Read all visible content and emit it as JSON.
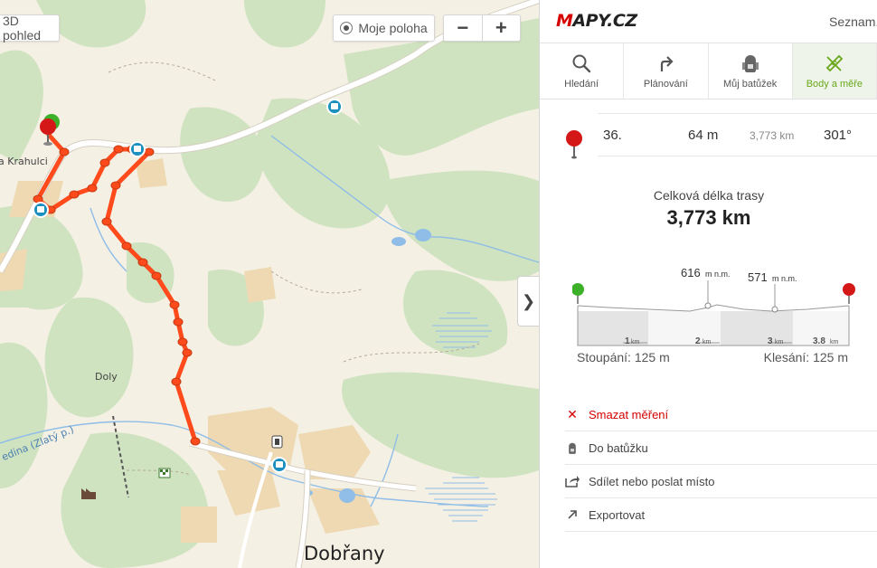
{
  "map": {
    "view3d_label": "3D pohled",
    "my_location_label": "Moje poloha",
    "zoom_out_label": "−",
    "zoom_in_label": "+",
    "collapse_label": "❯",
    "place_labels": {
      "krahulci": "a Krahulci",
      "doly": "Doly",
      "river": "edina (Zlatý p.)",
      "town": "Dobřany"
    }
  },
  "header": {
    "logo_initial": "M",
    "logo_rest": "APY.CZ",
    "account_label": "Seznam.c"
  },
  "tabs": [
    {
      "label": "Hledání",
      "icon": "search-icon"
    },
    {
      "label": "Plánování",
      "icon": "route-arrow-icon"
    },
    {
      "label": "Můj batůžek",
      "icon": "backpack-icon"
    },
    {
      "label": "Body a měře",
      "icon": "measure-ruler-icon",
      "active": true
    }
  ],
  "measurement": {
    "point": {
      "number": "36.",
      "elevation": "64 m",
      "distance": "3,773 km",
      "angle": "301°"
    },
    "total_label": "Celková délka trasy",
    "total_value": "3,773 km",
    "profile": {
      "peak1": {
        "value": "616",
        "unit": "m n.m."
      },
      "peak2": {
        "value": "571",
        "unit": "m n.m."
      },
      "ticks": [
        {
          "value": "1",
          "unit": "km"
        },
        {
          "value": "2",
          "unit": "km"
        },
        {
          "value": "3",
          "unit": "km"
        },
        {
          "value": "3.8",
          "unit": "km"
        }
      ]
    },
    "ascent": "Stoupání: 125 m",
    "descent": "Klesání: 125 m"
  },
  "actions": [
    {
      "label": "Smazat měření",
      "icon": "delete-x-icon"
    },
    {
      "label": "Do batůžku",
      "icon": "backpack-icon"
    },
    {
      "label": "Sdílet nebo poslat místo",
      "icon": "share-icon"
    },
    {
      "label": "Exportovat",
      "icon": "export-arrow-icon"
    }
  ],
  "colors": {
    "route": "#ff4a1c",
    "forest": "#cfe3c0",
    "meadow": "#f4f0e4",
    "field": "#eed9b3",
    "water": "#8fbde8",
    "accent_green": "#6aa81a",
    "brand_red": "#d40000"
  }
}
